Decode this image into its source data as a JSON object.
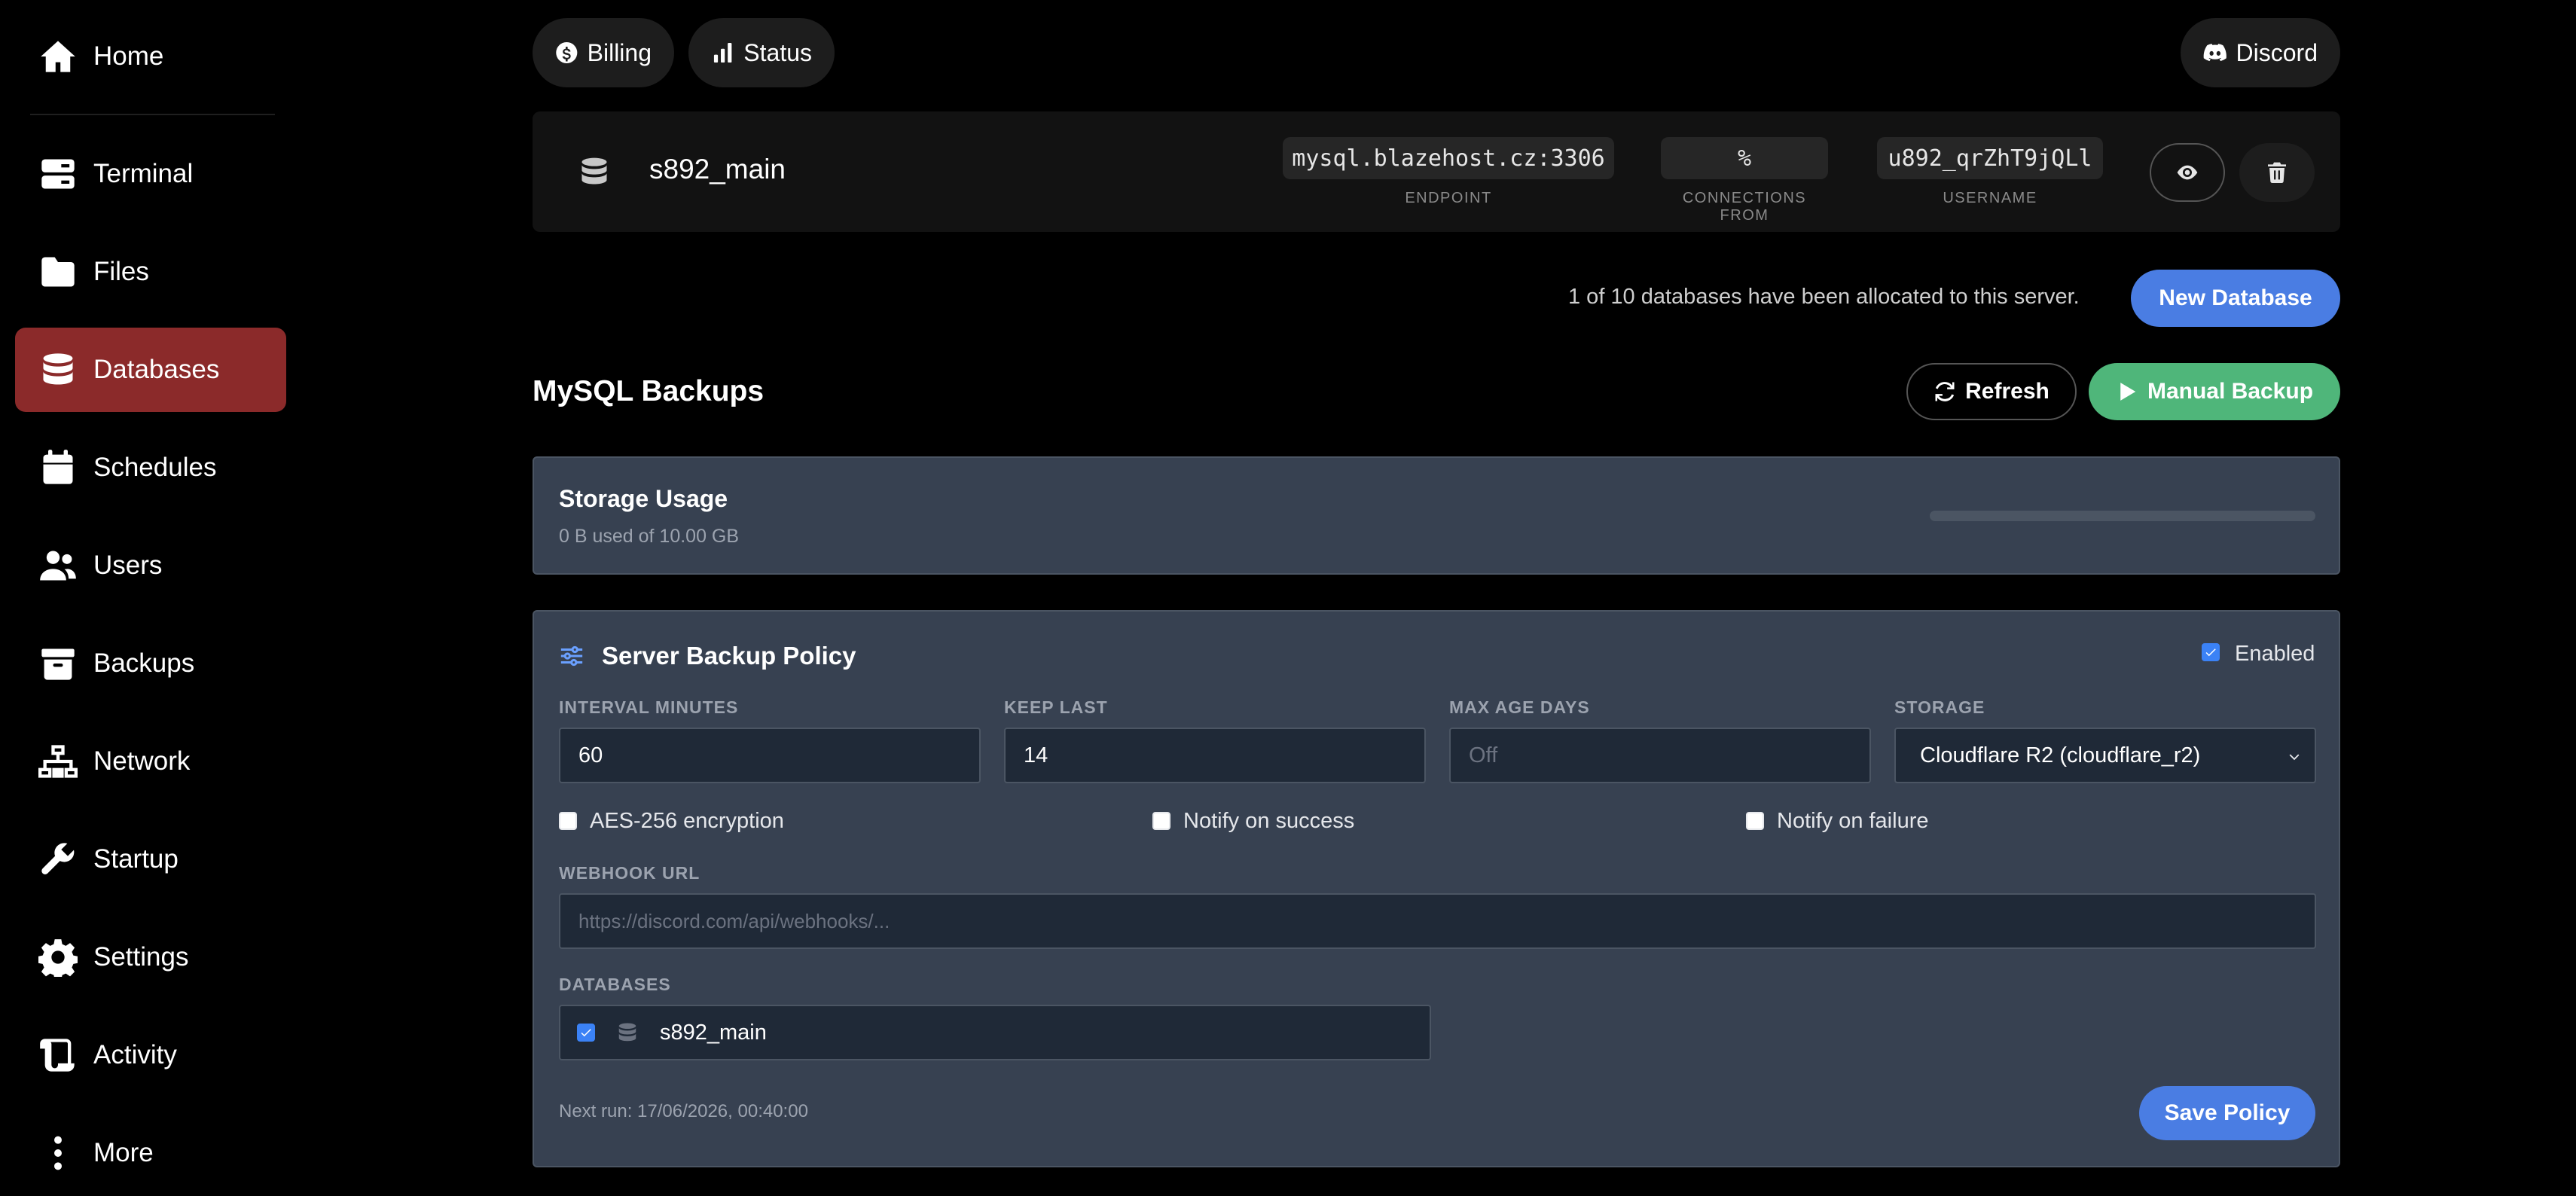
{
  "sidebar": {
    "items": [
      {
        "label": "Home",
        "icon": "home-icon"
      },
      {
        "label": "Terminal",
        "icon": "terminal-icon"
      },
      {
        "label": "Files",
        "icon": "folder-icon"
      },
      {
        "label": "Databases",
        "icon": "database-icon",
        "active": true
      },
      {
        "label": "Schedules",
        "icon": "calendar-icon"
      },
      {
        "label": "Users",
        "icon": "users-icon"
      },
      {
        "label": "Backups",
        "icon": "archive-icon"
      },
      {
        "label": "Network",
        "icon": "network-icon"
      },
      {
        "label": "Startup",
        "icon": "wrench-icon"
      },
      {
        "label": "Settings",
        "icon": "gear-icon"
      },
      {
        "label": "Activity",
        "icon": "activity-scroll-icon"
      },
      {
        "label": "More",
        "icon": "more-vertical-icon"
      }
    ]
  },
  "topbar": {
    "billing_label": "Billing",
    "status_label": "Status",
    "discord_label": "Discord"
  },
  "database": {
    "name": "s892_main",
    "endpoint": "mysql.blazehost.cz:3306",
    "endpoint_label": "ENDPOINT",
    "connections_from": "%",
    "connections_from_label": "CONNECTIONS FROM",
    "username": "u892_qrZhT9jQLl",
    "username_label": "USERNAME"
  },
  "allocation": {
    "text": "1 of 10 databases have been allocated to this server.",
    "new_button": "New Database"
  },
  "backups": {
    "title": "MySQL Backups",
    "refresh_label": "Refresh",
    "manual_label": "Manual Backup"
  },
  "storage": {
    "title": "Storage Usage",
    "usage_text": "0 B used of 10.00 GB",
    "used_fraction": 0
  },
  "policy": {
    "title": "Server Backup Policy",
    "enabled_label": "Enabled",
    "enabled": true,
    "interval_label": "INTERVAL MINUTES",
    "interval_value": "60",
    "keep_last_label": "KEEP LAST",
    "keep_last_value": "14",
    "max_age_label": "MAX AGE DAYS",
    "max_age_placeholder": "Off",
    "storage_label": "STORAGE",
    "storage_value": "Cloudflare R2 (cloudflare_r2)",
    "aes_label": "AES-256 encryption",
    "aes_checked": false,
    "notify_success_label": "Notify on success",
    "notify_success_checked": false,
    "notify_failure_label": "Notify on failure",
    "notify_failure_checked": false,
    "webhook_label": "WEBHOOK URL",
    "webhook_placeholder": "https://discord.com/api/webhooks/...",
    "databases_label": "DATABASES",
    "databases": [
      {
        "name": "s892_main",
        "checked": true
      }
    ],
    "next_run": "Next run: 17/06/2026, 00:40:00",
    "save_label": "Save Policy"
  },
  "colors": {
    "active_nav": "#8b2a2a",
    "accent_blue": "#4a7de3",
    "accent_green": "#4fb67a",
    "panel_bg": "#374151"
  }
}
